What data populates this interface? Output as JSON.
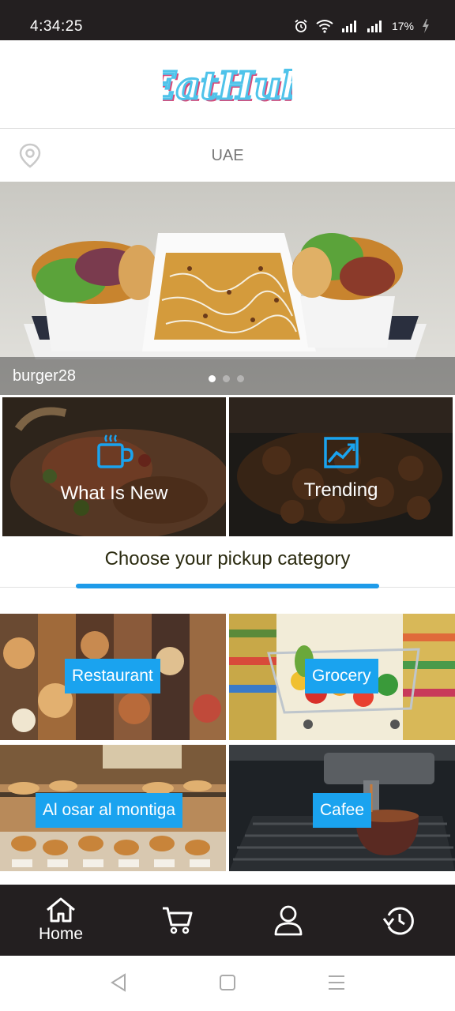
{
  "status_bar": {
    "time": "4:34:25",
    "battery_percent": "17%",
    "icons": [
      "alarm-icon",
      "wifi-icon",
      "signal-icon",
      "signal-icon",
      "battery-charging-icon"
    ]
  },
  "header": {
    "logo_text": "EatHub",
    "brand_colors": {
      "logo_fill": "#ffffff",
      "logo_outline": "#4fc3ea",
      "logo_shadow": "#d84a7a"
    }
  },
  "location": {
    "icon": "location-pin-icon",
    "value": "UAE"
  },
  "carousel": {
    "caption": "burger28",
    "slide_count": 3,
    "active_index": 0
  },
  "features": [
    {
      "label": "What Is New",
      "icon": "coffee-cup-icon"
    },
    {
      "label": "Trending",
      "icon": "trending-chart-icon"
    }
  ],
  "pickup": {
    "title": "Choose your pickup category",
    "accent_color": "#1e9be9"
  },
  "categories": [
    {
      "label": "Restaurant"
    },
    {
      "label": "Grocery"
    },
    {
      "label": "Al osar al montiga"
    },
    {
      "label": "Cafee"
    }
  ],
  "bottom_nav": {
    "items": [
      {
        "label": "Home",
        "icon": "home-icon",
        "active": true
      },
      {
        "label": "",
        "icon": "cart-icon",
        "active": false
      },
      {
        "label": "",
        "icon": "profile-icon",
        "active": false
      },
      {
        "label": "",
        "icon": "order-history-icon",
        "active": false
      }
    ]
  },
  "system_nav": {
    "icons": [
      "back-icon",
      "home-square-icon",
      "menu-icon"
    ]
  }
}
